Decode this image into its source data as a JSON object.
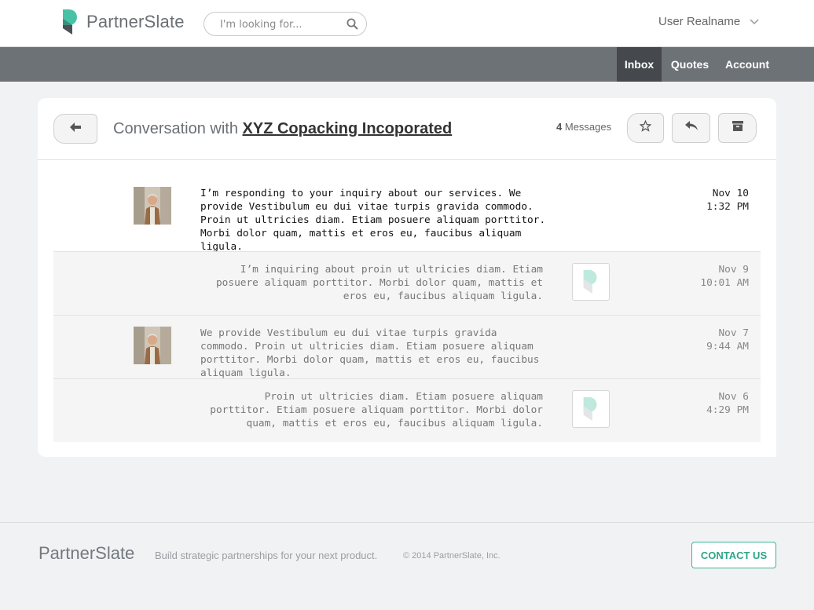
{
  "brand": {
    "name": "PartnerSlate",
    "accent": "#3fb49a"
  },
  "search": {
    "placeholder": "I'm looking for..."
  },
  "user": {
    "name": "User Realname"
  },
  "nav": {
    "items": [
      {
        "label": "Inbox",
        "active": true
      },
      {
        "label": "Quotes"
      },
      {
        "label": "Account"
      }
    ]
  },
  "conversation": {
    "title_prefix": "Conversation with",
    "partner": "XYZ Copacking Incoporated",
    "count": "4",
    "count_label": "Messages",
    "messages": [
      {
        "text": "I’m responding to your inquiry about our services. We provide Vestibulum eu dui vitae turpis gravida commodo. Proin ut ultricies diam. Etiam posuere aliquam porttitor. Morbi dolor quam, mattis et eros eu, faucibus aliquam ligula.",
        "date": "Nov 10",
        "time": "1:32 PM",
        "sender": "partner"
      },
      {
        "text": "I’m inquiring about proin ut ultricies diam. Etiam posuere aliquam porttitor. Morbi dolor quam, mattis et eros eu, faucibus aliquam ligula.",
        "date": "Nov 9",
        "time": "10:01 AM",
        "sender": "me"
      },
      {
        "text": "We provide Vestibulum eu dui vitae turpis gravida commodo. Proin ut ultricies diam. Etiam posuere aliquam porttitor. Morbi dolor quam, mattis et eros eu, faucibus aliquam ligula.",
        "date": "Nov 7",
        "time": "9:44 AM",
        "sender": "partner"
      },
      {
        "text": "Proin ut ultricies diam. Etiam posuere aliquam porttitor. Etiam posuere aliquam porttitor. Morbi dolor quam, mattis et eros eu, faucibus aliquam ligula.",
        "date": "Nov 6",
        "time": "4:29 PM",
        "sender": "me"
      }
    ]
  },
  "footer": {
    "logo": "PartnerSlate",
    "tagline": "Build strategic partnerships for your next product.",
    "copyright": "© 2014 PartnerSlate, Inc.",
    "contact": "CONTACT US"
  },
  "icons": [
    "partnerslate-logo-icon",
    "search-icon",
    "chevron-down-icon",
    "arrow-left-icon",
    "star-icon",
    "reply-icon",
    "archive-icon"
  ]
}
